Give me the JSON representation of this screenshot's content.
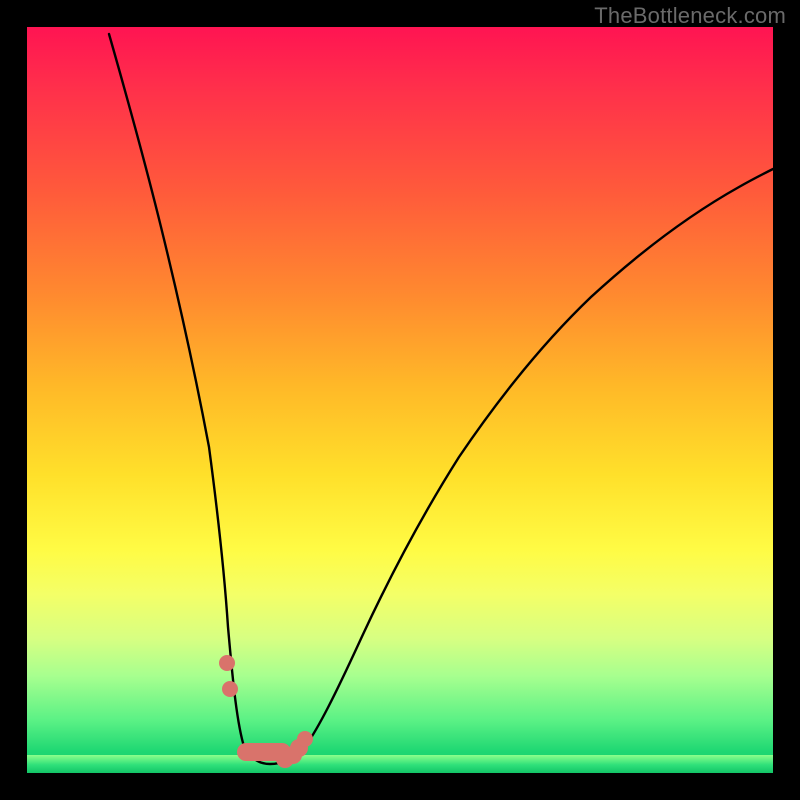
{
  "watermark": "TheBottleneck.com",
  "chart_data": {
    "type": "line",
    "title": "",
    "xlabel": "",
    "ylabel": "",
    "xlim": [
      0,
      100
    ],
    "ylim": [
      0,
      100
    ],
    "grid": false,
    "series": [
      {
        "name": "curve",
        "color": "#000000",
        "x": [
          11,
          13,
          15,
          17,
          19,
          21,
          23,
          25,
          26.5,
          27.7,
          28.8,
          30.2,
          31.5,
          33,
          34.5,
          36.5,
          39,
          42,
          46,
          51,
          57,
          63,
          69,
          75,
          81,
          88,
          95,
          100
        ],
        "y": [
          99,
          91,
          82,
          73,
          64,
          54,
          44,
          33,
          23,
          14,
          7,
          3,
          1.5,
          1.2,
          1.4,
          2,
          4,
          8,
          15,
          24,
          34,
          43,
          50,
          57,
          63,
          69,
          75,
          79
        ]
      },
      {
        "name": "markers",
        "color": "#D9736B",
        "points_x": [
          26.9,
          27.3,
          28.8,
          30.2,
          31.5,
          33.0,
          34.4,
          35.5,
          36.5,
          37.3
        ],
        "points_y": [
          15.0,
          11.5,
          3.6,
          2.0,
          1.5,
          1.4,
          1.6,
          2.2,
          3.2,
          4.8
        ]
      }
    ],
    "background_gradient": {
      "top_color": "#FF1452",
      "bottom_color": "#10C768"
    }
  }
}
